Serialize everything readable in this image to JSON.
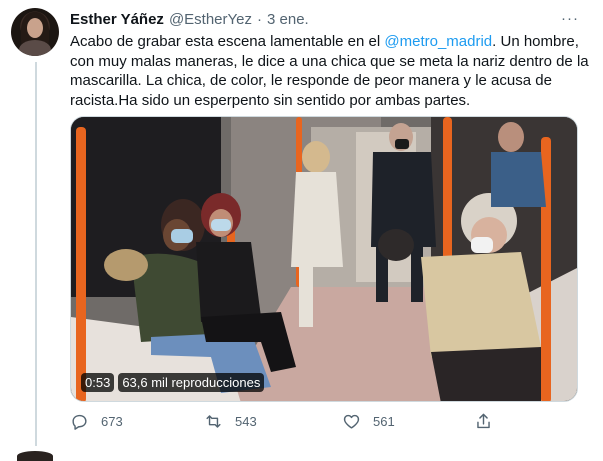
{
  "tweet": {
    "author_name": "Esther Yáñez",
    "author_handle": "@EstherYez",
    "separator": "·",
    "date": "3 ene.",
    "more_label": "···",
    "text_lines": [
      {
        "before": "Acabo de grabar esta escena lamentable en el ",
        "mention": "@metro_madrid",
        "after": ". Un hombre,"
      },
      {
        "before": "con muy malas maneras, le dice a una chica que se meta la nariz dentro de la",
        "mention": "",
        "after": ""
      },
      {
        "before": "mascarilla. La chica, de color, le responde de peor manera y le acusa de",
        "mention": "",
        "after": ""
      },
      {
        "before": "racista.Ha sido un esperpento sin sentido por ambas partes.",
        "mention": "",
        "after": ""
      }
    ],
    "video": {
      "duration": "0:53",
      "views": "63,6 mil reproducciones"
    },
    "actions": {
      "reply_count": "673",
      "retweet_count": "543",
      "like_count": "561"
    },
    "colors": {
      "link": "#1d9bf0",
      "secondary_text": "#536471",
      "handrail": "#e8651f"
    }
  }
}
